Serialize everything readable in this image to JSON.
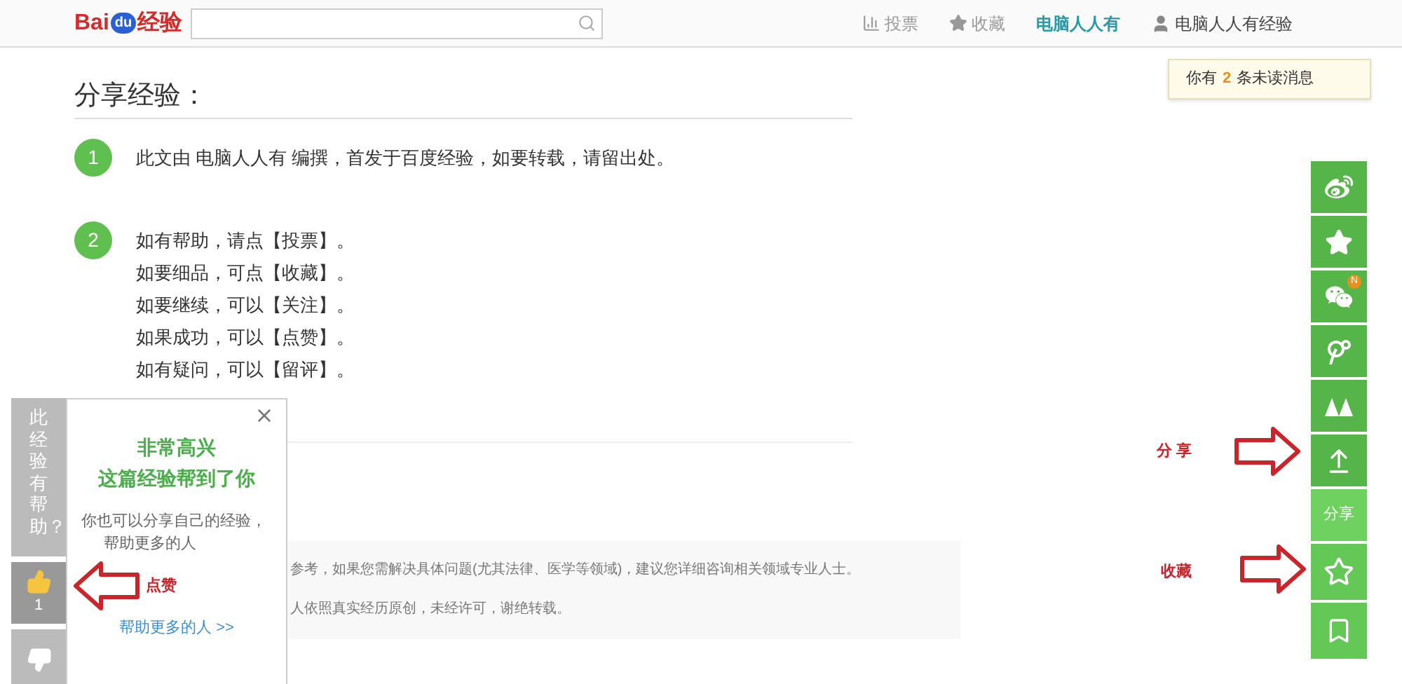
{
  "header": {
    "logo": {
      "text": "Bai",
      "badge": "du",
      "suffix": "经验"
    },
    "nav": [
      {
        "kind": "vote",
        "label": "投票"
      },
      {
        "kind": "favorite",
        "label": "收藏"
      },
      {
        "kind": "brand",
        "label": "电脑人人有"
      },
      {
        "kind": "user",
        "label": "电脑人人有经验"
      }
    ],
    "message": {
      "prefix": "你有",
      "count": "2",
      "suffix": "条未读消息"
    }
  },
  "title": "分享经验：",
  "steps": [
    {
      "number": "1",
      "lines": [
        "此文由 电脑人人有 编撰，首发于百度经验，如要转载，请留出处。"
      ]
    },
    {
      "number": "2",
      "lines": [
        "如有帮助，请点【投票】。",
        "如要细品，可点【收藏】。",
        "如要继续，可以【关注】。",
        "如果成功，可以【点赞】。",
        "如有疑问，可以【留评】。"
      ]
    }
  ],
  "notice": [
    "参考，如果您需解决具体问题(尤其法律、医学等领域)，建议您详细咨询相关领域专业人士。",
    "人依照真实经历原创，未经许可，谢绝转载。"
  ],
  "feedback": {
    "question": "此经验有帮助？",
    "likes": "1",
    "popup": {
      "heading": [
        "非常高兴",
        "这篇经验帮到了你"
      ],
      "text": [
        "你也可以分享自己的经验，",
        "帮助更多的人"
      ],
      "link": "帮助更多的人 >>"
    }
  },
  "share_bar": [
    {
      "kind": "weibo"
    },
    {
      "kind": "qzone"
    },
    {
      "kind": "wechat",
      "badge": "N"
    },
    {
      "kind": "tencent"
    },
    {
      "kind": "renren"
    },
    {
      "kind": "share"
    },
    {
      "kind": "label",
      "label": "分享"
    },
    {
      "kind": "favorite"
    },
    {
      "kind": "bookmark"
    }
  ],
  "annotations": [
    {
      "label": "分享"
    },
    {
      "label": "收藏"
    },
    {
      "label": "点赞"
    }
  ]
}
